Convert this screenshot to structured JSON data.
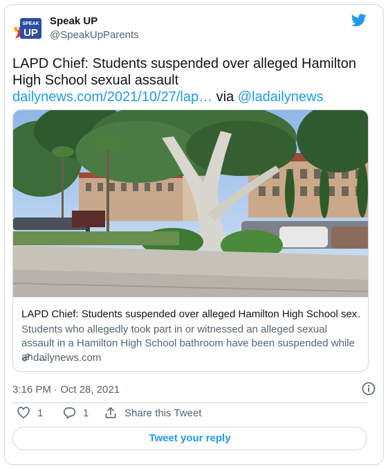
{
  "user": {
    "name": "Speak UP",
    "handle": "@SpeakUpParents",
    "avatar_text_top": "SPEAK",
    "avatar_text_bottom": "UP",
    "avatar_color": "#2b4fa3"
  },
  "tweet": {
    "text_before": "LAPD Chief: Students suspended over alleged Hamilton High School sexual assault ",
    "link": "dailynews.com/2021/10/27/lap…",
    "text_via": " via ",
    "mention": "@ladailynews"
  },
  "link_card": {
    "image_icon": "school-building-photo",
    "title": "LAPD Chief: Students suspended over alleged Hamilton High School sex…",
    "description": "Students who allegedly took part in or witnessed an alleged sexual assault in a Hamilton High School bathroom have been suspended while an …",
    "domain": "dailynews.com"
  },
  "timestamp": "3:16 PM · Oct 28, 2021",
  "actions": {
    "like_count": "1",
    "reply_count": "1",
    "share_label": "Share this Tweet"
  },
  "reply_button_label": "Tweet your reply",
  "colors": {
    "accent": "#1d9bf0",
    "text": "#0f1419",
    "secondary": "#536471",
    "border": "#cfd9de"
  }
}
